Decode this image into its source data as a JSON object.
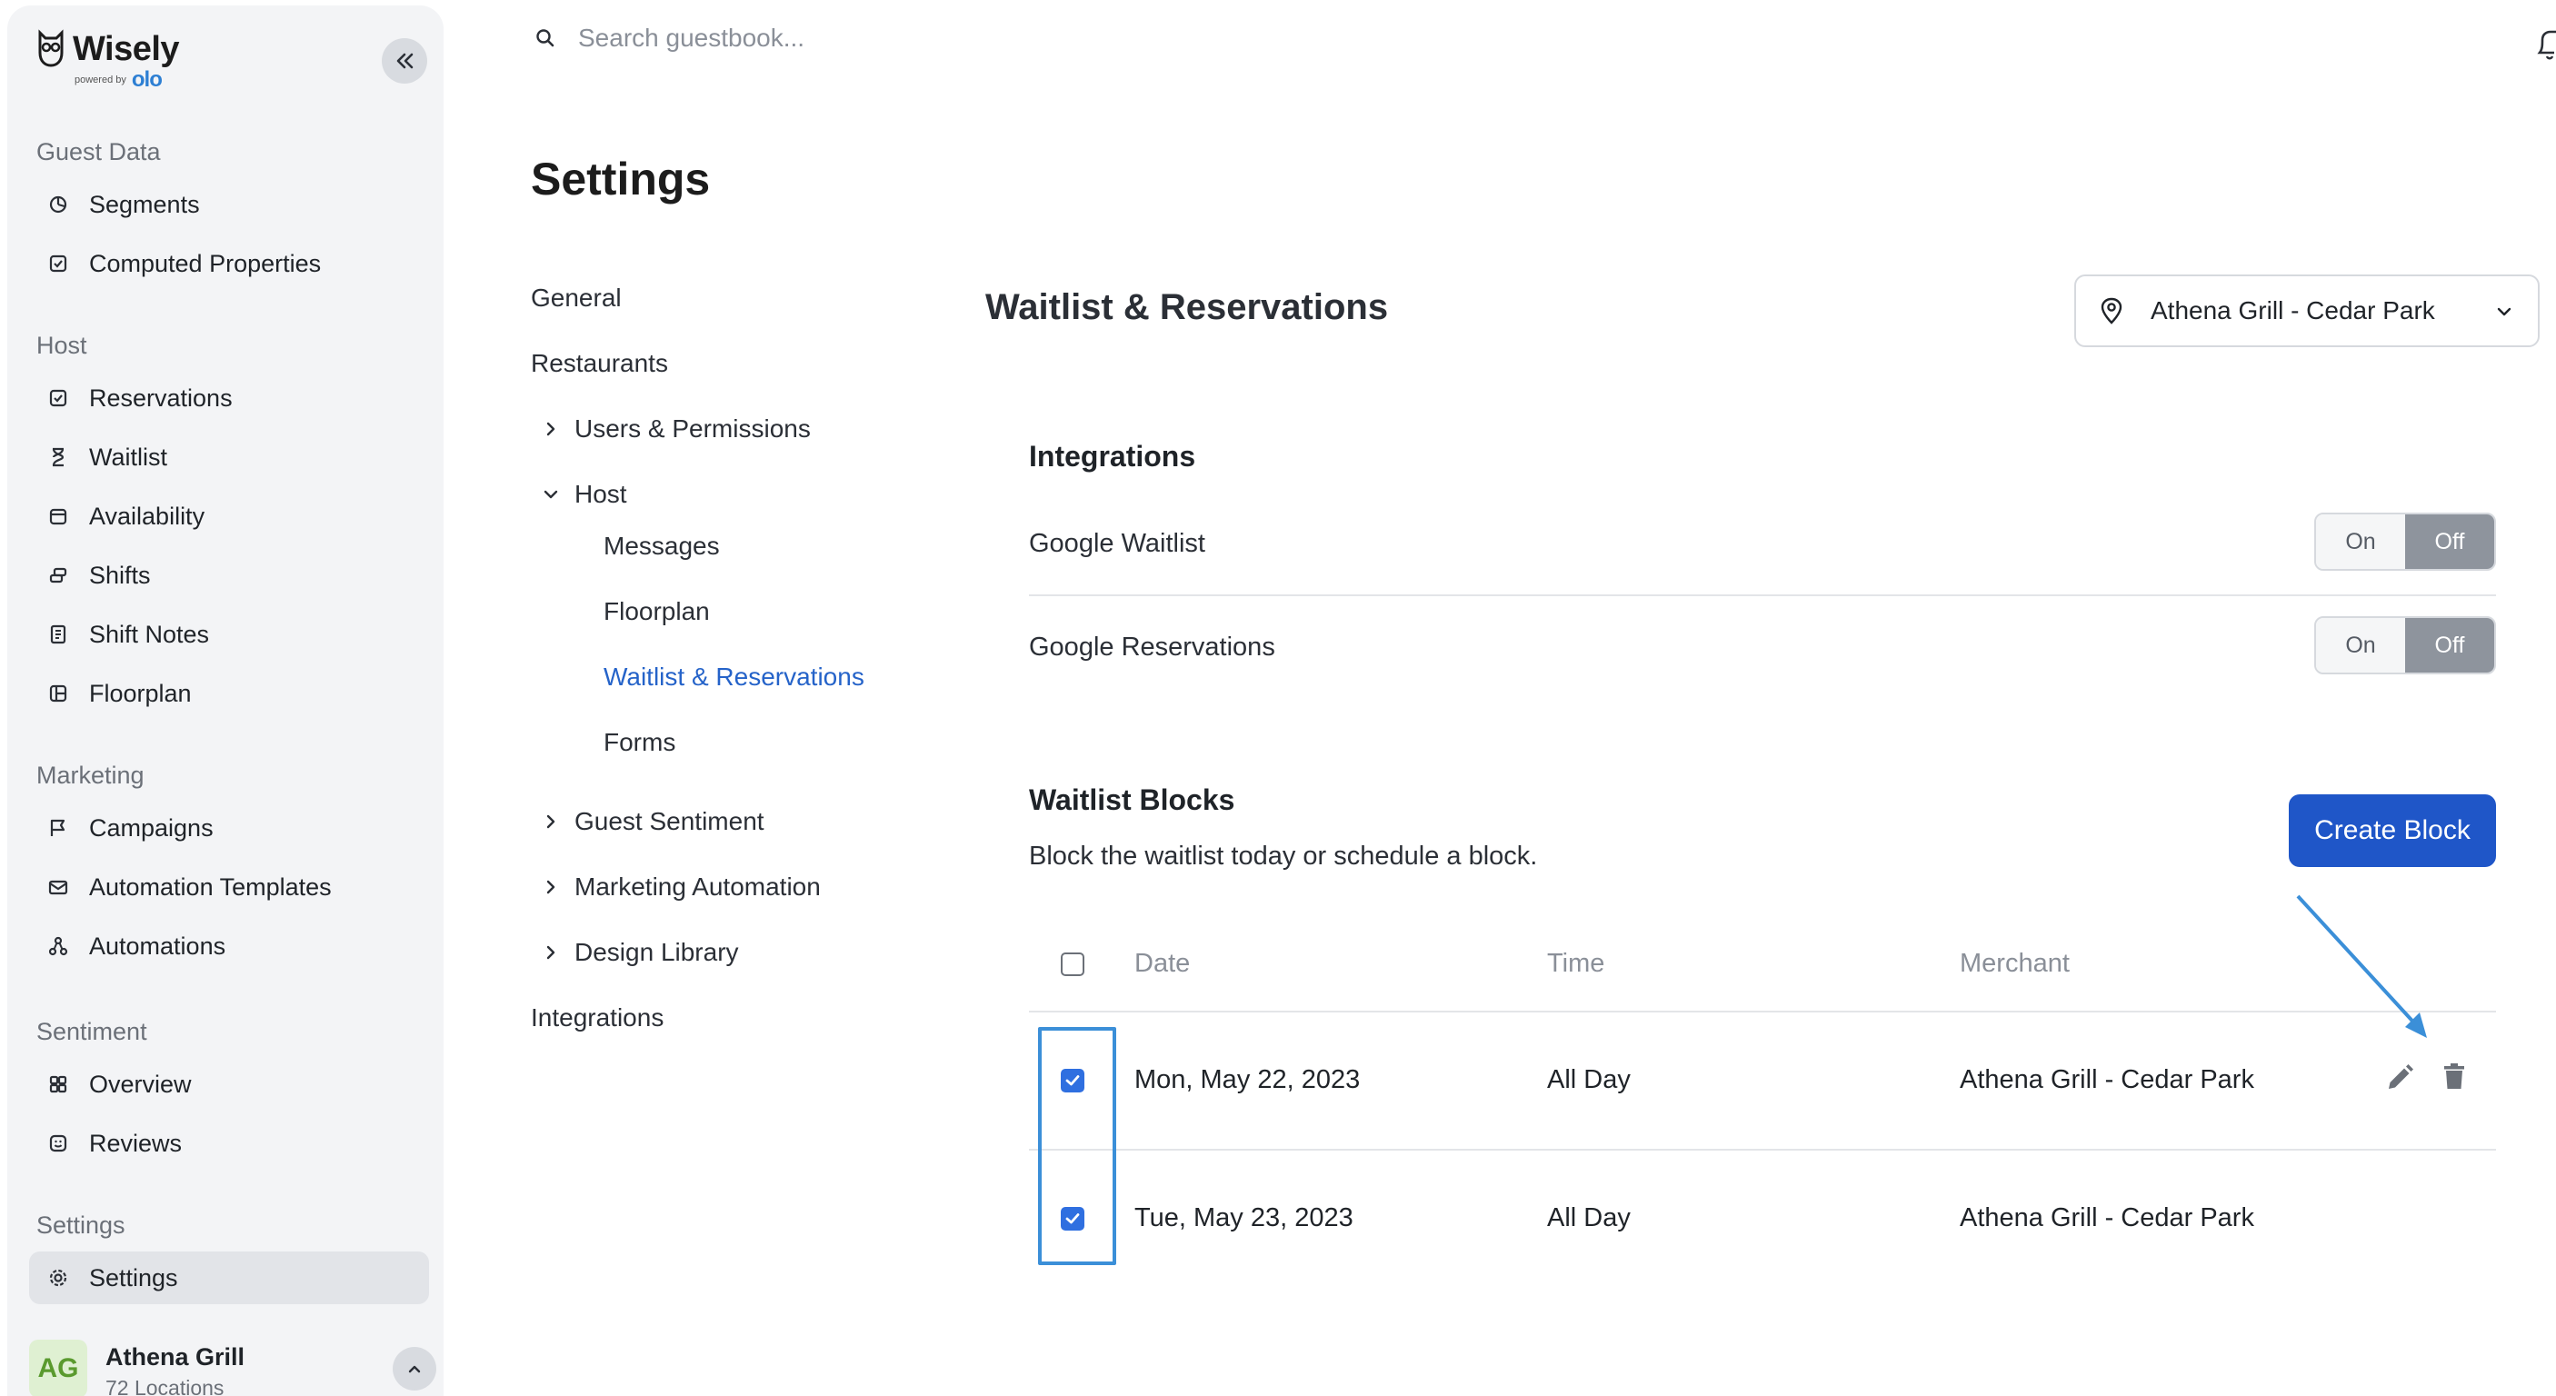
{
  "app": {
    "brand": "Wisely",
    "powered_by": "powered by",
    "partner": "olo"
  },
  "sidebar": {
    "sections": [
      {
        "label": "Guest Data",
        "items": [
          {
            "label": "Segments",
            "icon": "segments-icon"
          },
          {
            "label": "Computed Properties",
            "icon": "computed-properties-icon"
          }
        ]
      },
      {
        "label": "Host",
        "items": [
          {
            "label": "Reservations",
            "icon": "reservations-icon"
          },
          {
            "label": "Waitlist",
            "icon": "hourglass-icon"
          },
          {
            "label": "Availability",
            "icon": "availability-icon"
          },
          {
            "label": "Shifts",
            "icon": "shifts-icon"
          },
          {
            "label": "Shift Notes",
            "icon": "notes-icon"
          },
          {
            "label": "Floorplan",
            "icon": "floorplan-icon"
          }
        ]
      },
      {
        "label": "Marketing",
        "items": [
          {
            "label": "Campaigns",
            "icon": "flag-icon"
          },
          {
            "label": "Automation Templates",
            "icon": "mail-icon"
          },
          {
            "label": "Automations",
            "icon": "automations-icon"
          }
        ]
      },
      {
        "label": "Sentiment",
        "items": [
          {
            "label": "Overview",
            "icon": "grid-icon"
          },
          {
            "label": "Reviews",
            "icon": "reviews-icon"
          }
        ]
      },
      {
        "label": "Settings",
        "items": [
          {
            "label": "Settings",
            "icon": "gear-icon",
            "active": true
          }
        ]
      }
    ],
    "account": {
      "initials": "AG",
      "name": "Athena Grill",
      "sub": "72 Locations"
    }
  },
  "search": {
    "placeholder": "Search guestbook..."
  },
  "page": {
    "title": "Settings"
  },
  "subnav": {
    "general": "General",
    "restaurants": "Restaurants",
    "users_permissions": "Users & Permissions",
    "host": "Host",
    "messages": "Messages",
    "floorplan": "Floorplan",
    "waitlist_reservations": "Waitlist & Reservations",
    "forms": "Forms",
    "guest_sentiment": "Guest Sentiment",
    "marketing_automation": "Marketing Automation",
    "design_library": "Design Library",
    "integrations": "Integrations"
  },
  "panel": {
    "title": "Waitlist & Reservations",
    "location": "Athena Grill - Cedar Park",
    "integrations": {
      "heading": "Integrations",
      "rows": [
        {
          "label": "Google Waitlist",
          "on": "On",
          "off": "Off",
          "selected": "Off"
        },
        {
          "label": "Google Reservations",
          "on": "On",
          "off": "Off",
          "selected": "Off"
        }
      ]
    },
    "blocks": {
      "heading": "Waitlist Blocks",
      "description": "Block the waitlist today or schedule a block.",
      "create_label": "Create Block",
      "columns": [
        "Date",
        "Time",
        "Merchant"
      ],
      "rows": [
        {
          "date": "Mon, May 22, 2023",
          "time": "All Day",
          "merchant": "Athena Grill - Cedar Park",
          "checked": true
        },
        {
          "date": "Tue, May 23, 2023",
          "time": "All Day",
          "merchant": "Athena Grill - Cedar Park",
          "checked": true
        }
      ]
    }
  },
  "colors": {
    "accent": "#1f56c8",
    "active_link": "#2563c9",
    "annotation": "#3b8fd8"
  }
}
